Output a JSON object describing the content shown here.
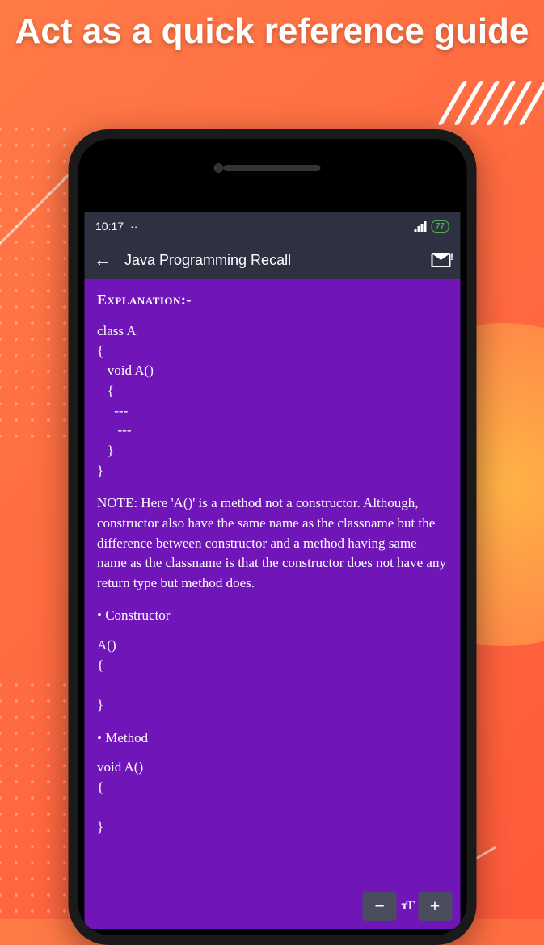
{
  "promo": {
    "title": "Act as a quick reference guide"
  },
  "status_bar": {
    "time": "10:17",
    "dots": "··",
    "battery": "77"
  },
  "app_bar": {
    "title": "Java Programming Recall"
  },
  "content": {
    "explanation_label": "Explanation:-",
    "code1": "class A\n{\n   void A()\n   {\n     ---\n      ---\n   }\n}",
    "note": "NOTE: Here 'A()' is a method not a constructor. Although, constructor also have the same name as the classname but the difference between constructor and a method having same name as the classname is that the constructor does not have any return type but method does.",
    "constructor_label": "• Constructor",
    "code2": "A()\n{\n\n}",
    "method_label": "• Method",
    "code3": "void A()\n{\n\n}"
  },
  "font_controls": {
    "decrease": "−",
    "label": "тT",
    "increase": "+"
  }
}
